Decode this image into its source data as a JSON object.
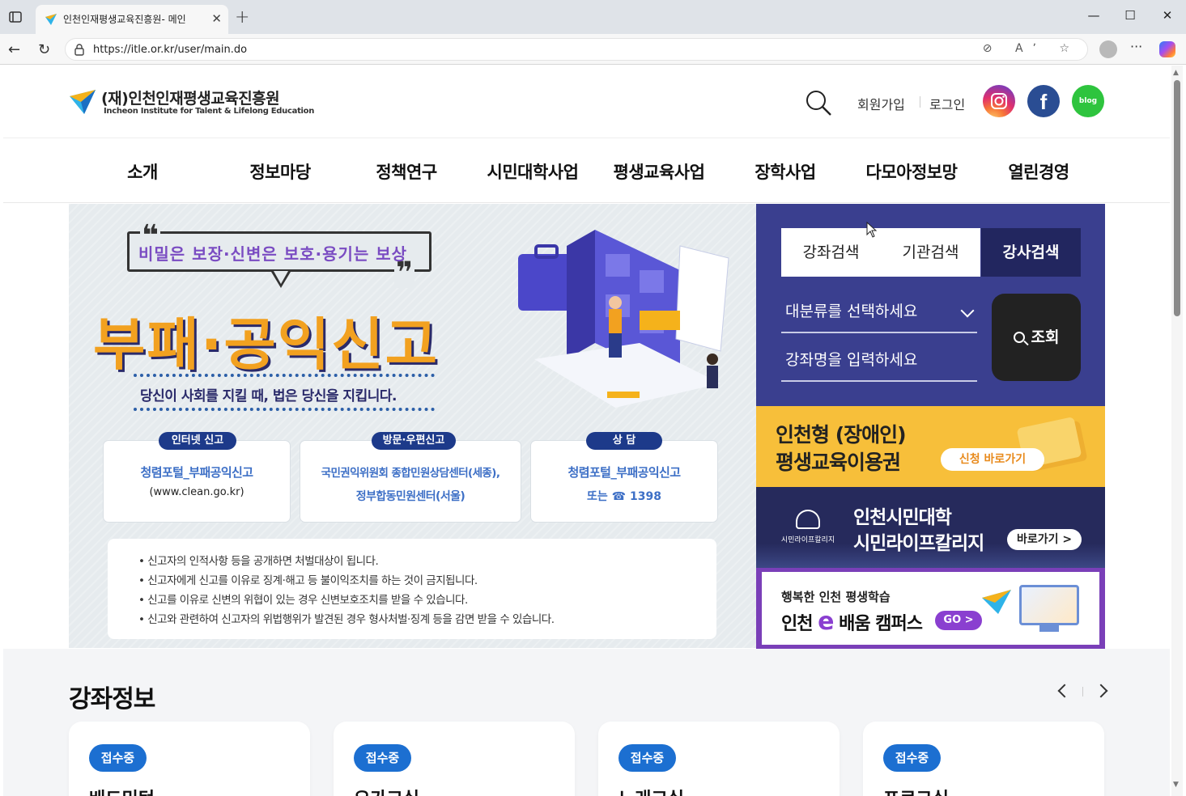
{
  "browser": {
    "tab_title": "인천인재평생교육진흥원- 메인",
    "url": "https://itle.or.kr/user/main.do",
    "newtab_glyph": "+",
    "close_glyph": "✕",
    "min_glyph": "—",
    "max_glyph": "☐",
    "winclose_glyph": "✕",
    "back_glyph": "←",
    "reload_glyph": "↻",
    "more_glyph": "···",
    "url_icons": "⊘ Aʼ ☆"
  },
  "header": {
    "logo_ko": "(재)인천인재평생교육진흥원",
    "logo_en": "Incheon Institute for Talent & Lifelong Education",
    "signup": "회원가입",
    "login": "로그인",
    "fb_glyph": "f",
    "blog_label": "blog"
  },
  "nav": {
    "items": [
      "소개",
      "정보마당",
      "정책연구",
      "시민대학사업",
      "평생교육사업",
      "장학사업",
      "다모아정보망",
      "열린경영"
    ]
  },
  "banner": {
    "quote_open": "❝",
    "quote_close": "❞",
    "quote": "비밀은 보장·신변은 보호·용기는 보상",
    "title": "부패·공익신고",
    "slogan": "당신이 사회를 지킬 때, 법은 당신을 지킵니다.",
    "cards": [
      {
        "tag": "인터넷 신고",
        "line1": "청렴포털_부패공익신고",
        "line2": "(www.clean.go.kr)"
      },
      {
        "tag": "방문·우편신고",
        "line1": "국민권익위원회 종합민원상담센터(세종),",
        "line2": "정부합동민원센터(서울)"
      },
      {
        "tag": "상 담",
        "line1": "청렴포털_부패공익신고",
        "line2": "또는 ☎ 1398"
      }
    ],
    "notices": [
      "• 신고자의 인적사항 등을 공개하면 처벌대상이 됩니다.",
      "• 신고자에게 신고를 이유로 징계·해고 등 불이익조치를 하는 것이 금지됩니다.",
      "• 신고를 이유로 신변의 위협이 있는 경우 신변보호조치를 받을 수 있습니다.",
      "• 신고와 관련하여 신고자의 위법행위가 발견된 경우 형사처벌·징계 등을 감면 받을 수 있습니다."
    ]
  },
  "search_panel": {
    "tabs": [
      "강좌검색",
      "기관검색",
      "강사검색"
    ],
    "active_tab": "강사검색",
    "select_placeholder": "대분류를 선택하세요",
    "input_placeholder": "강좌명을 입력하세요",
    "submit": "조회"
  },
  "promos": {
    "p1_line1": "인천형 (장애인)",
    "p1_line2": "평생교육이용권",
    "p1_btn": "신청 바로가기",
    "p2_emblem": "시민라이프칼리지",
    "p2_line1": "인천시민대학",
    "p2_line2": "시민라이프칼리지",
    "p2_btn": "바로가기  >",
    "p3_line1": "행복한 인천 평생학습",
    "p3_pre": "인천 ",
    "p3_e": "e",
    "p3_post": " 배움 캠퍼스",
    "p3_btn": "GO >"
  },
  "lectures": {
    "title": "강좌정보",
    "items": [
      {
        "status": "접수중",
        "name": "배드민턴"
      },
      {
        "status": "접수중",
        "name": "요가교실"
      },
      {
        "status": "접수중",
        "name": "노래교실"
      },
      {
        "status": "접수중",
        "name": "프로그실"
      }
    ]
  },
  "colors": {
    "nav_panel": "#3a3f8f",
    "active_tab": "#22265f",
    "promo_yellow": "#f7bf3a",
    "promo_navy": "#262a5c",
    "promo_purple": "#7a3fb8",
    "status_blue": "#1c6fd1"
  },
  "icons": [
    "panel-icon",
    "favicon-icon",
    "back-icon",
    "reload-icon",
    "lock-icon",
    "search-icon",
    "instagram-icon",
    "facebook-icon",
    "blog-icon",
    "chevron-down-icon",
    "chevron-left-icon",
    "chevron-right-icon"
  ]
}
